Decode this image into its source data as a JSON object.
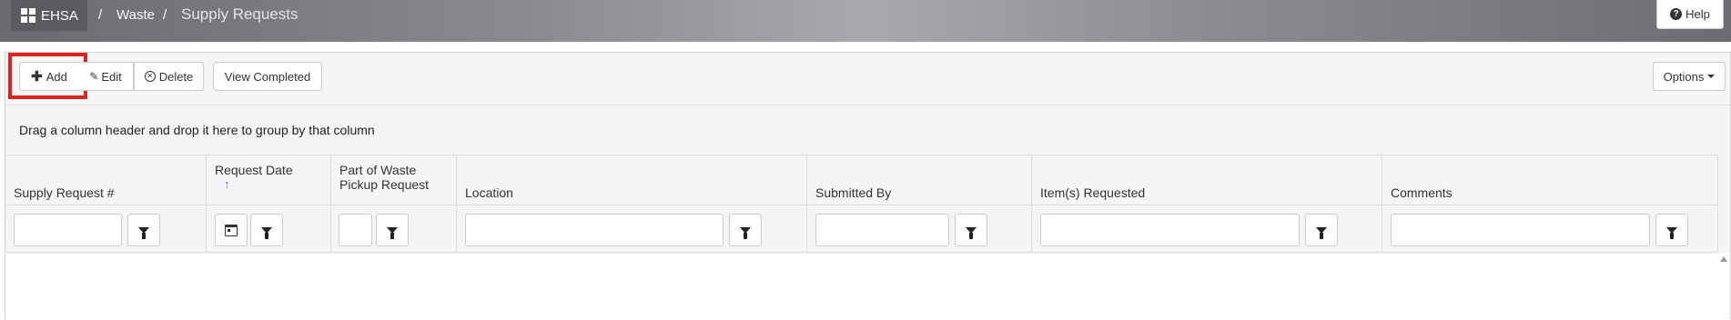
{
  "app": {
    "brand": "EHSA"
  },
  "breadcrumb": {
    "sep": "/",
    "waste": "Waste",
    "current": "Supply Requests"
  },
  "help": {
    "label": "Help"
  },
  "toolbar": {
    "add_label": "Add",
    "edit_label": "Edit",
    "delete_label": "Delete",
    "view_completed_label": "View Completed",
    "options_label": "Options"
  },
  "grid": {
    "group_hint": "Drag a column header and drop it here to group by that column",
    "columns": [
      "Supply Request #",
      "Request Date",
      "Part of Waste Pickup Request",
      "Location",
      "Submitted By",
      "Item(s) Requested",
      "Comments"
    ],
    "col2_line1": "Part of Waste",
    "col2_line2": "Pickup Request",
    "sort_indicator": "↑"
  },
  "icons": {
    "brand": "grid-icon",
    "help": "question-circle-icon",
    "add": "plus-icon",
    "edit": "pencil-icon",
    "delete": "x-circle-icon",
    "options": "caret-down-icon",
    "filter": "funnel-icon",
    "date": "calendar-icon"
  },
  "colors": {
    "highlight": "#e0211f",
    "sort_arrow": "#3a82c4"
  }
}
